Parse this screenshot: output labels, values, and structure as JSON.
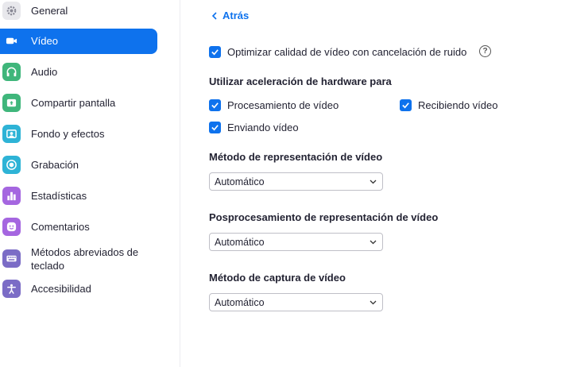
{
  "sidebar": {
    "items": [
      {
        "label": "General",
        "icon": "gear-icon",
        "color": "#e8e8ec"
      },
      {
        "label": "Vídeo",
        "icon": "video-camera-icon",
        "color": "#0e72ed"
      },
      {
        "label": "Audio",
        "icon": "headphones-icon",
        "color": "#3fb67b"
      },
      {
        "label": "Compartir pantalla",
        "icon": "share-screen-icon",
        "color": "#3fb67b"
      },
      {
        "label": "Fondo y efectos",
        "icon": "background-icon",
        "color": "#2eb3d6"
      },
      {
        "label": "Grabación",
        "icon": "record-icon",
        "color": "#2eb3d6"
      },
      {
        "label": "Estadísticas",
        "icon": "statistics-icon",
        "color": "#a566e0"
      },
      {
        "label": "Comentarios",
        "icon": "feedback-icon",
        "color": "#a566e0"
      },
      {
        "label": "Métodos abreviados de teclado",
        "icon": "keyboard-icon",
        "color": "#7b6cc6"
      },
      {
        "label": "Accesibilidad",
        "icon": "accessibility-icon",
        "color": "#7b6cc6"
      }
    ],
    "active_item": "Vídeo"
  },
  "main": {
    "back_label": "Atrás",
    "optimize_label": "Optimizar calidad de vídeo con cancelación de ruido",
    "help_glyph": "?",
    "hw_heading": "Utilizar aceleración de hardware para",
    "hw_options": {
      "processing": "Procesamiento de vídeo",
      "receiving": "Recibiendo vídeo",
      "sending": "Enviando vídeo"
    },
    "render_method_heading": "Método de representación de vídeo",
    "render_method_value": "Automático",
    "post_processing_heading": "Posprocesamiento de representación de vídeo",
    "post_processing_value": "Automático",
    "capture_method_heading": "Método de captura de vídeo",
    "capture_method_value": "Automático"
  },
  "colors": {
    "accent": "#0e72ed",
    "text": "#232333"
  }
}
